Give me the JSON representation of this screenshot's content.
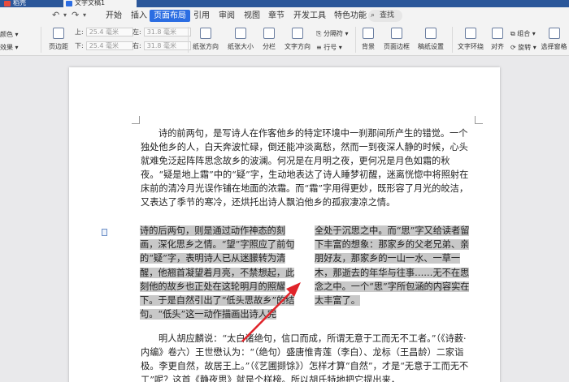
{
  "tabs": [
    {
      "label": "稻壳",
      "active": false
    },
    {
      "label": "文字文稿1",
      "active": true
    }
  ],
  "quick_access": {
    "undo": "↶",
    "redo": "↷",
    "dropdown": "▾"
  },
  "menu": [
    {
      "label": "开始",
      "active": false
    },
    {
      "label": "插入",
      "active": false
    },
    {
      "label": "页面布局",
      "active": true
    },
    {
      "label": "引用",
      "active": false
    },
    {
      "label": "审阅",
      "active": false
    },
    {
      "label": "视图",
      "active": false
    },
    {
      "label": "章节",
      "active": false
    },
    {
      "label": "开发工具",
      "active": false
    },
    {
      "label": "特色功能",
      "active": false
    }
  ],
  "search": {
    "label": "查找"
  },
  "ribbon": {
    "theme": "颜色",
    "effects": "效果",
    "margins": "页边距",
    "margin_top_label": "上:",
    "margin_top_value": "25.4 毫米",
    "margin_bottom_label": "下:",
    "margin_bottom_value": "25.4 毫米",
    "margin_left_label": "左:",
    "margin_left_value": "31.8 毫米",
    "margin_right_label": "右:",
    "margin_right_value": "31.8 毫米",
    "orientation": "纸张方向",
    "size": "纸张大小",
    "columns": "分栏",
    "text_direction": "文字方向",
    "break": "分隔符",
    "line_numbers": "行号",
    "background": "背景",
    "page_border": "页面边框",
    "paper_settings": "稿纸设置",
    "text_wrap": "文字环绕",
    "align": "对齐",
    "group": "组合",
    "rotate": "旋转",
    "select_pane": "选择窗格"
  },
  "document": {
    "para1": "诗的前两句，是写诗人在作客他乡的特定环境中一刹那间所产生的错觉。一个独处他乡的人，白天奔波忙碌，倒还能冲淡离愁，然而一到夜深人静的时候，心头就难免泛起阵阵思念故乡的波澜。何况是在月明之夜，更何况是月色如霜的秋夜。“疑是地上霜”中的“疑”字，生动地表达了诗人睡梦初醒，迷离恍惚中将照射在床前的清冷月光误作铺在地面的浓霜。而“霜”字用得更妙，既形容了月光的皎洁，又表达了季节的寒冷，还烘托出诗人飘泊他乡的孤寂凄凉之情。",
    "col1": "诗的后两句，则是通过动作神态的刻画，深化思乡之情。“望”字照应了前句的“疑”字，表明诗人已从迷朦转为清醒，他翘首凝望着月亮，不禁想起，此刻他的故乡也正处在这轮明月的照耀下。于是自然引出了“低头思故乡”的结句。“低头”这一动作描画出诗人完",
    "col2": "全处于沉思之中。而“思”字又给读者留下丰富的想象：那家乡的父老兄弟、亲朋好友，那家乡的一山一水、一草一木，那逝去的年华与往事……无不在思念之中。一个“思”字所包涵的内容实在太丰富了。",
    "para3": "明人胡应麟说：“太白诸绝句，信口而成，所谓无意于工而无不工者。”（《诗薮·内编》卷六）王世懋认为：“（绝句）盛唐惟青莲（李白）、龙标（王昌龄）二家诣极。李更自然，故居王上。”（《艺圃撷馀》）怎样才算“自然”，才是“无意于工而无不工”呢？这首《静夜思》就是个样榜。所以胡氏特地把它提出来，"
  },
  "colors": {
    "accent": "#2b6de2",
    "highlight": "#c8c8c8",
    "arrow": "#e0242a"
  }
}
